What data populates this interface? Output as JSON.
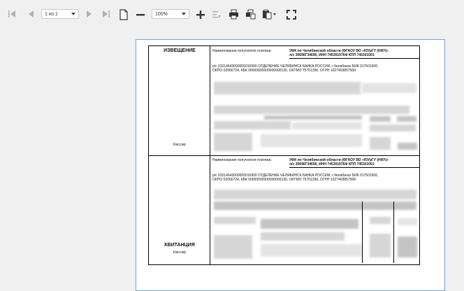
{
  "toolbar": {
    "page_indicator": "1 из 1",
    "zoom_value": "100%"
  },
  "document": {
    "top": {
      "title": "ИЗВЕЩЕНИЕ",
      "cashier": "Кассир",
      "recipient_label": "Наименование получателя платежа:",
      "recipient_name": "УФК по Челябинской области (ФГАОУ ВО «ЮУрГУ (НИУ)»",
      "recipient_account": "л/с 30696Г34690, ИНН 7453019764/ КПП 745301001",
      "bank_line1": "р/с 03214643000000016900 ОТДЕЛЕНИЕ ЧЕЛЯБИНСК БАНКА РОССИИ, г.Челябинск БИК 017501500,",
      "bank_line2": "ОКПО 02066724, КБК 00000000000000000130, ОКТМО 75701390, ОГРН 1027403857568"
    },
    "bottom": {
      "title": "КВИТАНЦИЯ",
      "cashier": "Кассир",
      "recipient_label": "Наименование получателя платежа:",
      "recipient_name": "УФК по Челябинской области (ФГАОУ ВО «ЮУрГУ (НИУ)»",
      "recipient_account": "л/с 30696Г34690, ИНН 7453019764/ КПП 745301001",
      "bank_line1": "р/с 03214643000000016900 ОТДЕЛЕНИЕ ЧЕЛЯБИНСК БАНКА РОССИИ, г.Челябинск БИК 017501500,",
      "bank_line2": "ОКПО 02066724, КБК 00000000000000000130, ОКТМО 75701390, ОГРН 1027403857568"
    }
  }
}
